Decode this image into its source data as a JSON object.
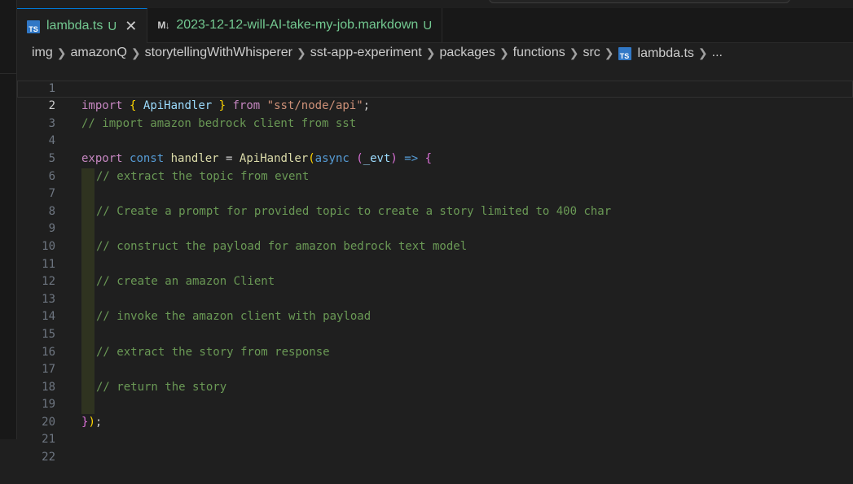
{
  "tabs": [
    {
      "icon": "TS",
      "name": "lambda.ts",
      "status": "U",
      "close": "✕",
      "active": true
    },
    {
      "icon": "M↓",
      "name": "2023-12-12-will-AI-take-my-job.markdown",
      "status": "U",
      "active": false
    }
  ],
  "breadcrumb": {
    "items": [
      "img",
      "amazonQ",
      "storytellingWithWhisperer",
      "sst-app-experiment",
      "packages",
      "functions",
      "src"
    ],
    "file_icon": "TS",
    "file": "lambda.ts",
    "more": "..."
  },
  "editor": {
    "line_numbers": [
      "1",
      "2",
      "3",
      "4",
      "5",
      "6",
      "7",
      "8",
      "9",
      "10",
      "11",
      "12",
      "13",
      "14",
      "15",
      "16",
      "17",
      "18",
      "19",
      "20",
      "21",
      "22"
    ],
    "current_line": 2,
    "line1": {
      "kw": "import",
      "open": "{",
      "name": "ApiHandler",
      "close": "}",
      "from": "from",
      "module": "\"sst/node/api\"",
      "semi": ";"
    },
    "line2": "// import amazon bedrock client from sst",
    "line4": {
      "export": "export",
      "const": "const",
      "var": "handler",
      "eq": " = ",
      "fn": "ApiHandler",
      "paren_open": "(",
      "async": "async",
      "param_open": "(",
      "param": "_evt",
      "param_close": ")",
      "arrow": " => ",
      "brace": "{"
    },
    "comments": {
      "l5": "// extract the topic from event",
      "l7": "// Create a prompt for provided topic to create a story limited to 400 char",
      "l9": "// construct the payload for amazon bedrock text model",
      "l11": "// create an amazon Client",
      "l13": "// invoke the amazon client with payload",
      "l15": "// extract the story from response",
      "l17": "// return the story"
    },
    "line19": {
      "brace": "}",
      "paren": ")",
      "semi": ";"
    }
  }
}
